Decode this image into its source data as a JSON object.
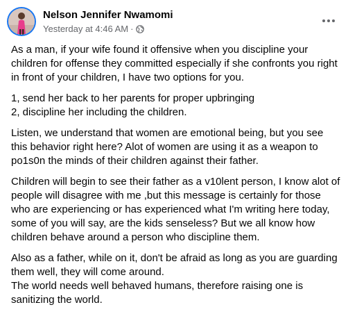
{
  "post": {
    "author": "Nelson Jennifer Nwamomi",
    "timestamp": "Yesterday at 4:46 AM",
    "separator": "·",
    "audience_icon": "globe-icon",
    "more_icon": "more-options-icon",
    "paragraphs": [
      {
        "lines": [
          "As a man, if your wife found it offensive when you  discipline your",
          "children for offense they committed especially if she confronts you right",
          "in front of your children, I have two options for you."
        ]
      },
      {
        "lines": [
          "1, send her back to her parents for proper upbringing",
          "2, discipline her including the children."
        ]
      },
      {
        "lines": [
          "Listen, we understand that women are emotional being, but you see",
          "this behavior right here? Alot of women are using it as a weapon to",
          "po1s0n the minds of their children against their father."
        ]
      },
      {
        "lines": [
          "Children will begin to see their father as a v10lent person, I know alot of",
          "people will disagree with me ,but this message is certainly for those",
          "who are experiencing or has experienced what I'm writing here today,",
          "some of you will say, are the kids senseless? But we all know how",
          "children behave around a person who discipline them."
        ]
      },
      {
        "lines": [
          "Also as a father, while on it, don't be afraid as long as you are guarding",
          "them well, they will come around.",
          "The world needs well behaved humans, therefore raising one is",
          "sanitizing the world."
        ]
      }
    ]
  },
  "colors": {
    "text": "#050505",
    "secondary_text": "#65676b",
    "accent": "#1877f2"
  }
}
